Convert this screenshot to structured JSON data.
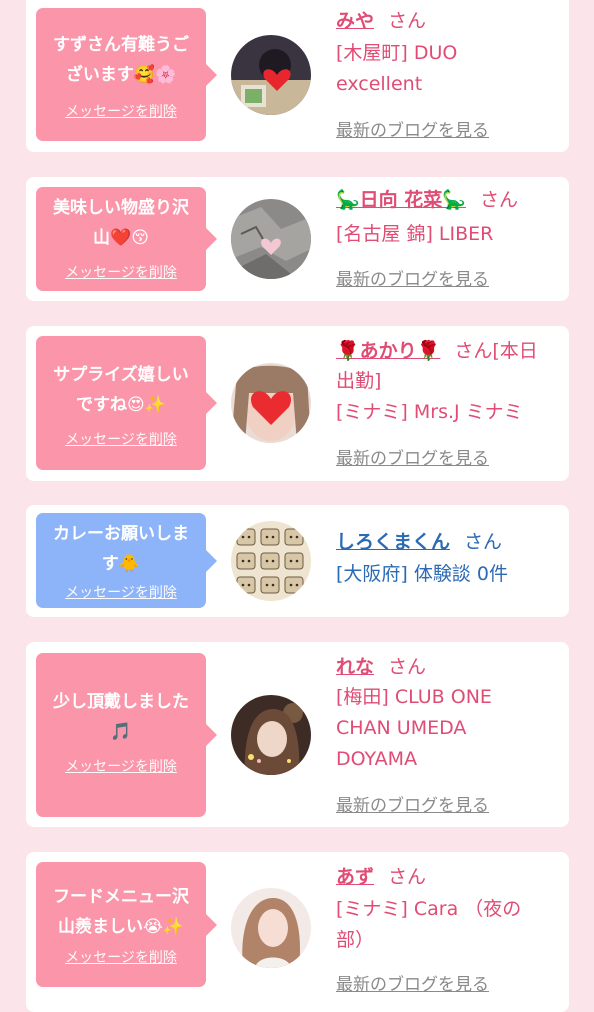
{
  "delete_label": "メッセージを削除",
  "blog_label": "最新のブログを見る",
  "san_label": "さん",
  "items": [
    {
      "message_lines": [
        "すずさん有難うご",
        "ざいます🥰🌸"
      ],
      "name": "みや",
      "san": "さん",
      "desc_lines": [
        "[木屋町] DUO",
        "excellent"
      ],
      "has_blog": true,
      "theme": "pink"
    },
    {
      "message_lines": [
        "美味しい物盛り沢",
        "山❤️😚"
      ],
      "name": "🦕日向 花菜🦕",
      "san": "さん",
      "desc_lines": [
        "[名古屋 錦] LIBER"
      ],
      "has_blog": true,
      "theme": "pink"
    },
    {
      "message_lines": [
        "サプライズ嬉しい",
        "ですね😍✨"
      ],
      "name": "🌹あかり🌹",
      "san": "さん[本日",
      "desc_lines": [
        "出勤]",
        "[ミナミ] Mrs.J ミナミ"
      ],
      "has_blog": true,
      "theme": "pink"
    },
    {
      "message_lines": [
        "カレーお願いしま",
        "す🐥"
      ],
      "name": "しろくまくん",
      "san": "さん",
      "desc_lines": [
        "[大阪府] 体験談 0件"
      ],
      "has_blog": false,
      "theme": "blue"
    },
    {
      "message_lines": [
        "少し頂戴しました",
        "🎵"
      ],
      "name": "れな",
      "san": "さん",
      "desc_lines": [
        "[梅田] CLUB ONE",
        "CHAN UMEDA",
        "DOYAMA"
      ],
      "has_blog": true,
      "theme": "pink"
    },
    {
      "message_lines": [
        "フードメニュー沢",
        "山羨ましい😭✨"
      ],
      "name": "あず",
      "san": "さん",
      "desc_lines": [
        "[ミナミ] Cara （夜の",
        "部）"
      ],
      "has_blog": true,
      "theme": "pink"
    }
  ]
}
